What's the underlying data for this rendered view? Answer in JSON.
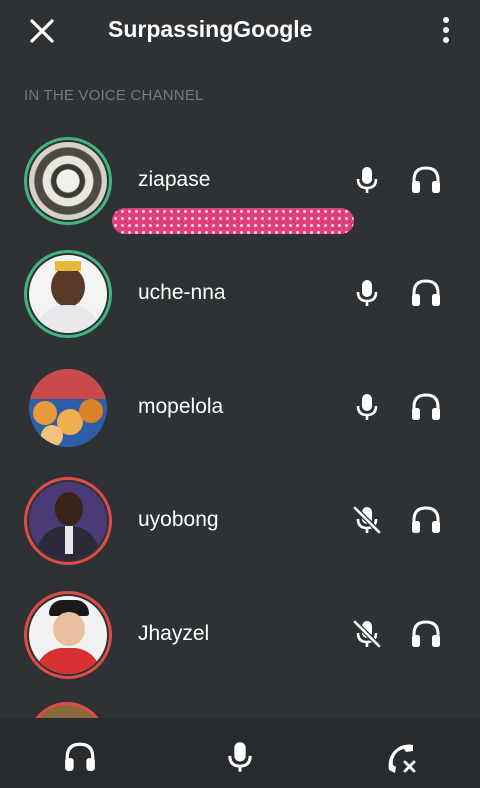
{
  "header": {
    "title": "SurpassingGoogle",
    "close_icon": "close-icon",
    "menu_icon": "more-vertical-icon"
  },
  "section": {
    "label": "IN THE VOICE CHANNEL"
  },
  "members": [
    {
      "name": "ziapase",
      "status": "speaking",
      "mic": "mic-icon",
      "headset": "headset-icon"
    },
    {
      "name": "uche-nna",
      "status": "speaking",
      "mic": "mic-icon",
      "headset": "headset-icon"
    },
    {
      "name": "mopelola",
      "status": "idle",
      "mic": "mic-icon",
      "headset": "headset-icon"
    },
    {
      "name": "uyobong",
      "status": "muted",
      "mic": "mic-muted-icon",
      "headset": "headset-icon"
    },
    {
      "name": "Jhayzel",
      "status": "muted",
      "mic": "mic-muted-icon",
      "headset": "headset-icon"
    }
  ],
  "bottom_bar": {
    "buttons": [
      "headset-icon",
      "mic-icon",
      "disconnect-call-icon"
    ]
  },
  "colors": {
    "background": "#2f3234",
    "bottom_bar": "#282b2e",
    "speaking_ring": "#43b581",
    "muted_ring": "#e04b47",
    "section_label": "#737a80"
  }
}
